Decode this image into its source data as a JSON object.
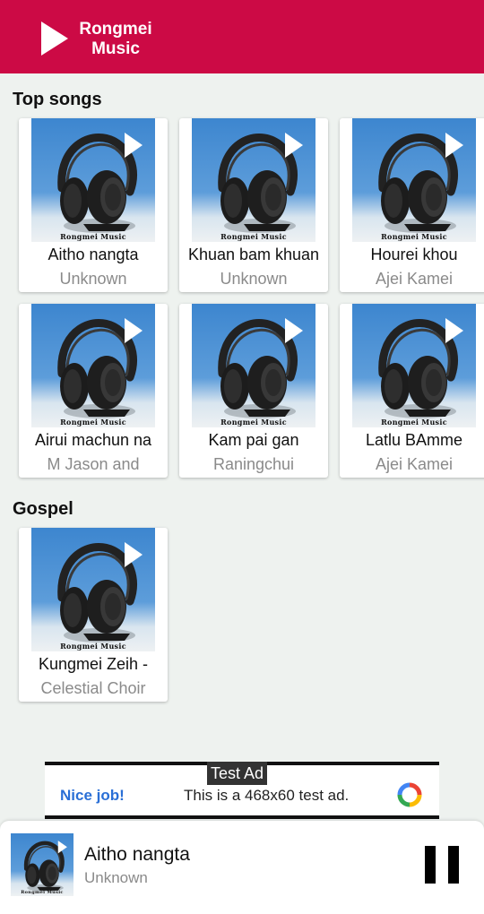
{
  "header": {
    "app_name_line1": "Rongmei",
    "app_name_line2": "Music",
    "icon": "play-icon"
  },
  "sections": [
    {
      "title": "Top songs",
      "songs": [
        {
          "title": "Aitho nangta",
          "artist": "Unknown"
        },
        {
          "title": "Khuan bam khuan",
          "artist": "Unknown"
        },
        {
          "title": "Hourei khou",
          "artist": "Ajei Kamei"
        },
        {
          "title": "Airui machun na",
          "artist": "M Jason and"
        },
        {
          "title": "Kam pai gan",
          "artist": "Raningchui"
        },
        {
          "title": "Latlu BAmme",
          "artist": "Ajei Kamei"
        }
      ]
    },
    {
      "title": "Gospel",
      "songs": [
        {
          "title": "Kungmei Zeih -",
          "artist": "Celestial Choir"
        }
      ]
    }
  ],
  "thumbnail_label": "Rongmei Music",
  "ad": {
    "badge": "Test Ad",
    "nice": "Nice job!",
    "text": "This is a 468x60 test ad."
  },
  "player": {
    "title": "Aitho nangta",
    "artist": "Unknown",
    "state_icon": "pause-icon"
  },
  "colors": {
    "header": "#cc0a45",
    "background": "#eef2ef",
    "ad_link": "#2a6fd6"
  }
}
